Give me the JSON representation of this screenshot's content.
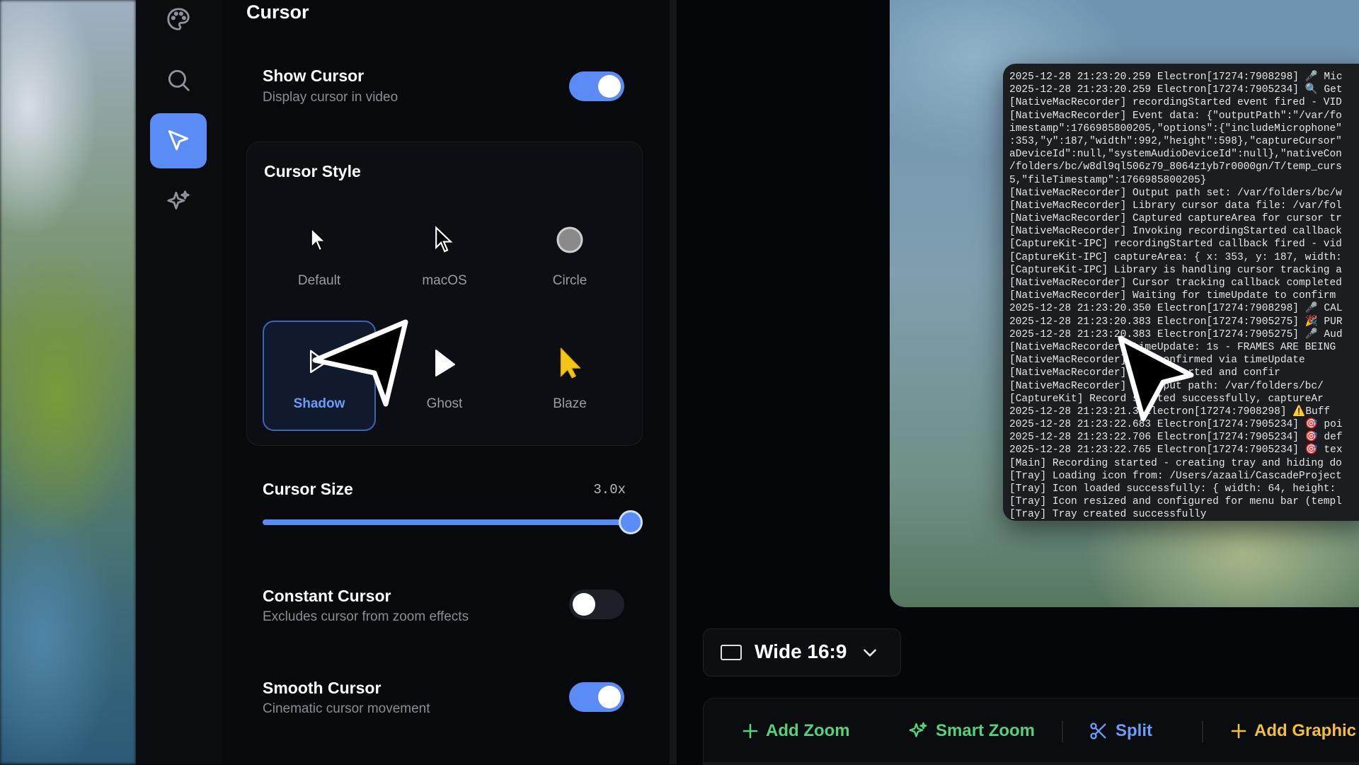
{
  "panel": {
    "title": "Cursor",
    "show_cursor": {
      "title": "Show Cursor",
      "subtitle": "Display cursor in video",
      "enabled": true
    },
    "cursor_style": {
      "title": "Cursor Style",
      "options": [
        {
          "label": "Default",
          "icon": "arrow-cursor-icon"
        },
        {
          "label": "macOS",
          "icon": "macos-cursor-icon"
        },
        {
          "label": "Circle",
          "icon": "circle-cursor-icon"
        },
        {
          "label": "Shadow",
          "icon": "shadow-cursor-icon"
        },
        {
          "label": "Ghost",
          "icon": "ghost-cursor-icon"
        },
        {
          "label": "Blaze",
          "icon": "blaze-cursor-icon"
        }
      ],
      "selected": "Shadow"
    },
    "cursor_size": {
      "title": "Cursor Size",
      "value": "3.0x",
      "fraction": 1.0
    },
    "constant_cursor": {
      "title": "Constant Cursor",
      "subtitle": "Excludes cursor from zoom effects",
      "enabled": false
    },
    "smooth_cursor": {
      "title": "Smooth Cursor",
      "subtitle": "Cinematic cursor movement",
      "enabled": true
    }
  },
  "rail": {
    "items": [
      {
        "icon": "palette-icon",
        "active": false
      },
      {
        "icon": "search-icon",
        "active": false
      },
      {
        "icon": "cursor-icon",
        "active": true
      },
      {
        "icon": "sparkles-icon",
        "active": false
      }
    ]
  },
  "terminal": {
    "lines": [
      "2025-12-28 21:23:20.259 Electron[17274:7908298] 🎤 Mic",
      "2025-12-28 21:23:20.259 Electron[17274:7905234] 🔍 Get",
      "[NativeMacRecorder] recordingStarted event fired - VID",
      "[NativeMacRecorder] Event data: {\"outputPath\":\"/var/fo",
      "imestamp\":1766985800205,\"options\":{\"includeMicrophone\"",
      ":353,\"y\":187,\"width\":992,\"height\":598},\"captureCursor\"",
      "aDeviceId\":null,\"systemAudioDeviceId\":null},\"nativeCon",
      "/folders/bc/w8dl9ql506z79_8064z1yb7r0000gn/T/temp_curs",
      "5,\"fileTimestamp\":1766985800205}",
      "[NativeMacRecorder] Output path set: /var/folders/bc/w",
      "[NativeMacRecorder] Library cursor data file: /var/fol",
      "[NativeMacRecorder] Captured captureArea for cursor tr",
      "[NativeMacRecorder] Invoking recordingStarted callback",
      "[CaptureKit-IPC] recordingStarted callback fired - vid",
      "[CaptureKit-IPC] captureArea: { x: 353, y: 187, width:",
      "[CaptureKit-IPC] Library is handling cursor tracking a",
      "[NativeMacRecorder] Cursor tracking callback completed",
      "[NativeMacRecorder] Waiting for timeUpdate to confirm",
      "2025-12-28 21:23:20.350 Electron[17274:7908298] 🎤 CAL",
      "2025-12-28 21:23:20.383 Electron[17274:7905275] 🎉 PUR",
      "2025-12-28 21:23:20.383 Electron[17274:7905275] 🎤 Aud",
      "[NativeMacRecorder] timeUpdate: 1s - FRAMES ARE BEING",
      "[NativeMacRecorder] ing confirmed via timeUpdate",
      "[NativeMacRecorder] fully started and confir",
      "[NativeMacRecorder] l output path: /var/folders/bc/",
      "[CaptureKit] Record started successfully, captureAr",
      "2025-12-28 21:23:21.3 Electron[17274:7908298] ⚠️Buff",
      "2025-12-28 21:23:22.683 Electron[17274:7905234] 🎯 poi",
      "2025-12-28 21:23:22.706 Electron[17274:7905234] 🎯 def",
      "2025-12-28 21:23:22.765 Electron[17274:7905234] 🎯 tex",
      "[Main] Recording started - creating tray and hiding do",
      "[Tray] Loading icon from: /Users/azaali/CascadeProject",
      "[Tray] Icon loaded successfully: { width: 64, height:",
      "[Tray] Icon resized and configured for menu bar (templ",
      "[Tray] Tray created successfully"
    ]
  },
  "aspect": {
    "label": "Wide 16:9",
    "icon": "frame-icon"
  },
  "toolbar": {
    "add_zoom": "Add Zoom",
    "smart_zoom": "Smart Zoom",
    "split": "Split",
    "add_graphic": "Add Graphic"
  },
  "colors": {
    "accent": "#5b8cf5",
    "green": "#56d07a",
    "yellow": "#f2bf3c"
  }
}
